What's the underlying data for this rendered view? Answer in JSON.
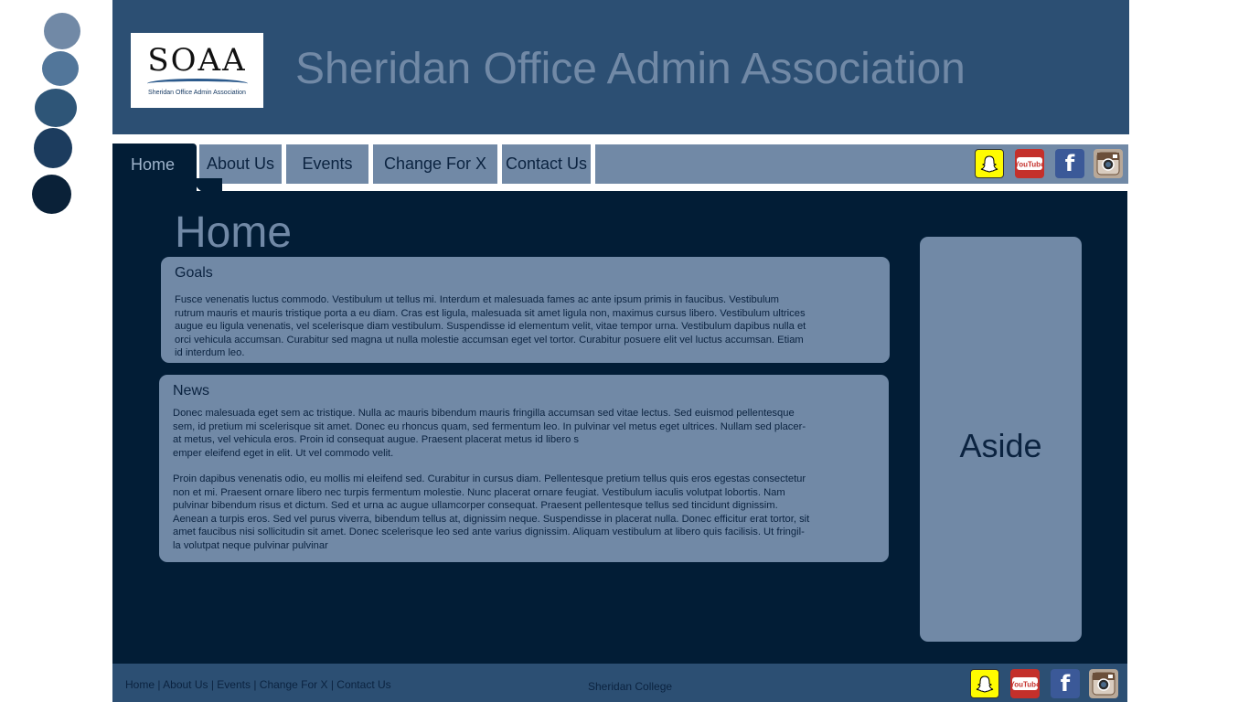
{
  "site": {
    "title": "Sheridan Office Admin Association",
    "logo_text": "SOAA",
    "logo_subtext": "Sheridan Office Admin Association"
  },
  "nav": {
    "items": [
      {
        "label": "Home",
        "active": true
      },
      {
        "label": "About Us"
      },
      {
        "label": "Events"
      },
      {
        "label": "Change For X"
      },
      {
        "label": "Contact Us"
      }
    ]
  },
  "social": {
    "icons": [
      "snapchat-icon",
      "youtube-icon",
      "facebook-icon",
      "instagram-icon"
    ],
    "youtube_text": "YouTube",
    "facebook_text": "f"
  },
  "main": {
    "title": "Home",
    "goals": {
      "title": "Goals",
      "lines": [
        "Fusce venenatis luctus commodo. Vestibulum ut tellus mi. Interdum et malesuada fames ac ante ipsum primis in faucibus. Vestibulum",
        "rutrum mauris et mauris tristique porta a eu diam. Cras est ligula, malesuada sit amet ligula non, maximus cursus libero. Vestibulum ultrices",
        "augue eu ligula venenatis, vel scelerisque diam vestibulum. Suspendisse id elementum velit, vitae tempor urna. Vestibulum dapibus nulla et",
        "orci vehicula accumsan. Curabitur sed magna ut nulla molestie accumsan eget vel tortor. Curabitur posuere elit vel luctus accumsan. Etiam",
        "id interdum leo."
      ]
    },
    "news": {
      "title": "News",
      "paragraph1": [
        "Donec malesuada eget sem ac tristique. Nulla ac mauris bibendum mauris fringilla accumsan sed vitae lectus. Sed euismod pellentesque",
        "sem, id pretium mi scelerisque sit amet. Donec eu rhoncus quam, sed fermentum leo. In pulvinar vel metus eget ultrices. Nullam sed placer-",
        "at metus, vel vehicula eros. Proin id consequat augue. Praesent placerat metus id libero s",
        "emper eleifend eget in elit. Ut vel commodo velit."
      ],
      "paragraph2": [
        "Proin dapibus venenatis odio, eu mollis mi eleifend sed. Curabitur in cursus diam. Pellentesque pretium tellus quis eros egestas consectetur",
        "non et mi. Praesent ornare libero nec turpis fermentum molestie. Nunc placerat ornare feugiat. Vestibulum iaculis volutpat lobortis. Nam",
        "pulvinar bibendum risus et dictum. Sed et urna ac augue ullamcorper consequat. Praesent pellentesque tellus sed tincidunt dignissim.",
        "Aenean a turpis eros. Sed vel purus viverra, bibendum tellus at, dignissim neque. Suspendisse in placerat nulla. Donec efficitur erat tortor, sit",
        "amet faucibus nisi sollicitudin sit amet. Donec scelerisque leo sed ante varius dignissim. Aliquam vestibulum at libero quis facilisis. Ut fringil-",
        "la volutpat neque pulvinar pulvinar"
      ]
    },
    "aside": "Aside"
  },
  "footer": {
    "links": [
      "Home",
      "About Us",
      "Events",
      "Change For X",
      "Contact Us"
    ],
    "separator": " | ",
    "college": "Sheridan College"
  },
  "colors": {
    "header": "#2c4f73",
    "nav": "#7189a6",
    "main": "#021d36",
    "panel": "#7189a6",
    "title_text": "#7189a6",
    "dark_text": "#0b2340"
  }
}
